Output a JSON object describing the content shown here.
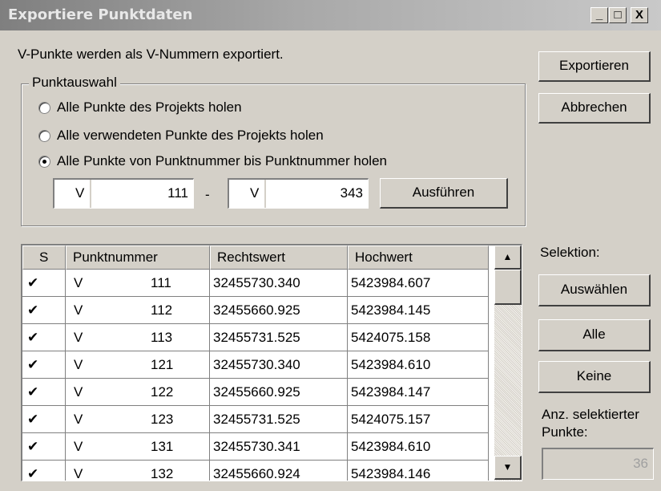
{
  "window": {
    "title": "Exportiere Punktdaten",
    "min": "_",
    "max": "□",
    "close": "X"
  },
  "intro": "V-Punkte werden als V-Nummern exportiert.",
  "group": {
    "legend": "Punktauswahl",
    "options": [
      {
        "label": "Alle Punkte des Projekts holen",
        "selected": false
      },
      {
        "label": "Alle verwendeten Punkte des Projekts holen",
        "selected": false
      },
      {
        "label": "Alle Punkte von Punktnummer bis Punktnummer holen",
        "selected": true
      }
    ],
    "from": {
      "prefix": "V",
      "value": "111"
    },
    "dash": "-",
    "to": {
      "prefix": "V",
      "value": "343"
    },
    "run_label": "Ausführen"
  },
  "buttons": {
    "export": "Exportieren",
    "cancel": "Abbrechen",
    "select": "Auswählen",
    "all": "Alle",
    "none": "Keine"
  },
  "selection_label": "Selektion:",
  "count_label_1": "Anz. selektierter",
  "count_label_2": "Punkte:",
  "count_value": "36",
  "table": {
    "headers": [
      "S",
      "Punktnummer",
      "Rechtswert",
      "Hochwert"
    ],
    "rows": [
      {
        "s": "✔",
        "prefix": "V",
        "num": "111",
        "rw": "32455730.340",
        "hw": "5423984.607"
      },
      {
        "s": "✔",
        "prefix": "V",
        "num": "112",
        "rw": "32455660.925",
        "hw": "5423984.145"
      },
      {
        "s": "✔",
        "prefix": "V",
        "num": "113",
        "rw": "32455731.525",
        "hw": "5424075.158"
      },
      {
        "s": "✔",
        "prefix": "V",
        "num": "121",
        "rw": "32455730.340",
        "hw": "5423984.610"
      },
      {
        "s": "✔",
        "prefix": "V",
        "num": "122",
        "rw": "32455660.925",
        "hw": "5423984.147"
      },
      {
        "s": "✔",
        "prefix": "V",
        "num": "123",
        "rw": "32455731.525",
        "hw": "5424075.157"
      },
      {
        "s": "✔",
        "prefix": "V",
        "num": "131",
        "rw": "32455730.341",
        "hw": "5423984.610"
      },
      {
        "s": "✔",
        "prefix": "V",
        "num": "132",
        "rw": "32455660.924",
        "hw": "5423984.146"
      }
    ],
    "scroll_up": "▲",
    "scroll_down": "▼"
  }
}
